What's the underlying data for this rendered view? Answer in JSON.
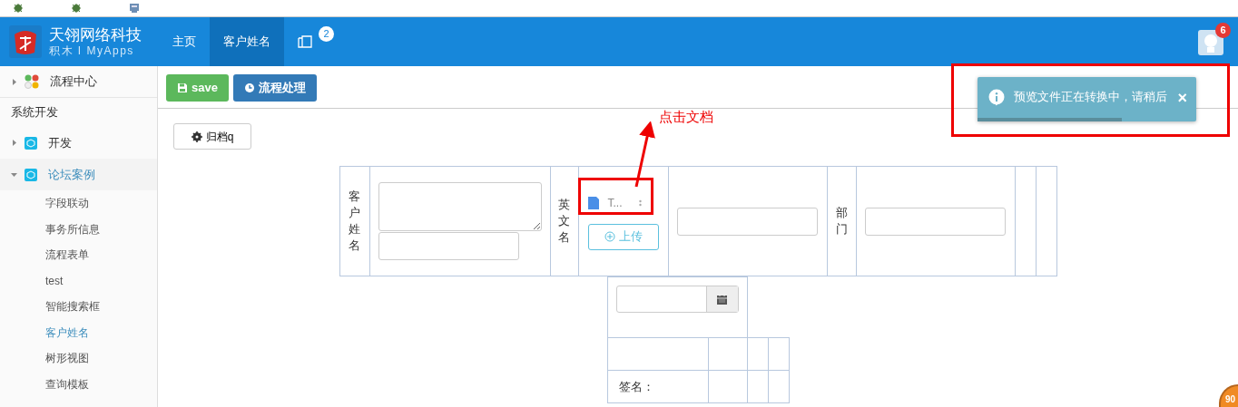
{
  "brand": {
    "title": "天翎网络科技",
    "subtitle": "积木 I MyApps"
  },
  "nav": [
    {
      "kind": "text",
      "label": "主页",
      "selected": false
    },
    {
      "kind": "text",
      "label": "客户姓名",
      "selected": true
    },
    {
      "kind": "icon",
      "badge": "2",
      "selected": false
    }
  ],
  "user_badge": "6",
  "sidebar": [
    {
      "kind": "group",
      "label": "流程中心",
      "expanded": false
    },
    {
      "kind": "section",
      "label": "系统开发"
    },
    {
      "kind": "group",
      "label": "开发",
      "expanded": false
    },
    {
      "kind": "group",
      "label": "论坛案例",
      "expanded": true,
      "children": [
        {
          "label": "字段联动",
          "selected": false
        },
        {
          "label": "事务所信息",
          "selected": false
        },
        {
          "label": "流程表单",
          "selected": false
        },
        {
          "label": "test",
          "selected": false
        },
        {
          "label": "智能搜索框",
          "selected": false
        },
        {
          "label": "客户姓名",
          "selected": true
        },
        {
          "label": "树形视图",
          "selected": false
        },
        {
          "label": "查询模板",
          "selected": false
        }
      ]
    }
  ],
  "toolbar": [
    {
      "kind": "save",
      "label": "save"
    },
    {
      "kind": "flow",
      "label": "流程处理"
    }
  ],
  "archive_button": "归档q",
  "form": {
    "customer_label": "客户姓名",
    "english_label": "英文名",
    "attachment": "T...",
    "upload": "上传",
    "dept_label": "部门",
    "signature_label": "签名："
  },
  "annotation": "点击文档",
  "toast": {
    "message": "预览文件正在转换中，请稍后",
    "close": "×",
    "level": 0.66
  },
  "corner_badge": "90"
}
